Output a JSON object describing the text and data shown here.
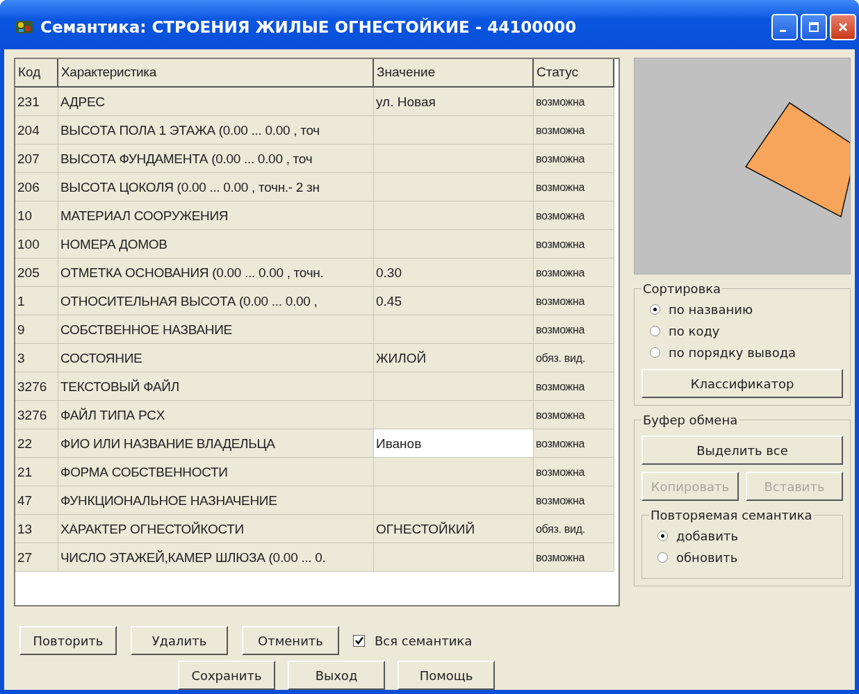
{
  "window": {
    "title": "Семантика: СТРОЕНИЯ ЖИЛЫЕ ОГНЕСТОЙКИЕ - 44100000"
  },
  "table": {
    "columns": [
      "Код",
      "Характеристика",
      "Значение",
      "Статус"
    ],
    "rows": [
      {
        "code": "231",
        "name": "АДРЕС",
        "value": "ул. Новая",
        "status": "возможна",
        "editing": false
      },
      {
        "code": "204",
        "name": "ВЫСОТА ПОЛА 1 ЭТАЖА  (0.00 ... 0.00 , точ",
        "status": "возможна",
        "editing": false
      },
      {
        "code": "207",
        "name": "ВЫСОТА ФУНДАМЕНТА  (0.00 ... 0.00 , точ",
        "status": "возможна",
        "editing": false
      },
      {
        "code": "206",
        "name": "ВЫСОТА ЦОКОЛЯ  (0.00 ... 0.00 , точн.- 2 зн",
        "status": "возможна",
        "editing": false
      },
      {
        "code": "10",
        "name": "МАТЕРИАЛ СООРУЖЕНИЯ",
        "status": "возможна",
        "editing": false
      },
      {
        "code": "100",
        "name": "НОМЕРА ДОМОВ",
        "status": "возможна",
        "editing": false
      },
      {
        "code": "205",
        "name": "ОТМЕТКА ОСНОВАНИЯ  (0.00 ... 0.00 , точн.",
        "value": "0.30",
        "status": "возможна",
        "editing": false
      },
      {
        "code": "1",
        "name": "ОТНОСИТЕЛЬНАЯ ВЫСОТА  (0.00 ... 0.00 ,",
        "value": "0.45",
        "status": "возможна",
        "editing": false
      },
      {
        "code": "9",
        "name": "СОБСТВЕННОЕ НАЗВАНИЕ",
        "status": "возможна",
        "editing": false
      },
      {
        "code": "3",
        "name": "СОСТОЯНИЕ",
        "value": "ЖИЛОЙ",
        "status": "обяз. вид.",
        "editing": false
      },
      {
        "code": "3276",
        "name": "ТЕКСТОВЫЙ ФАЙЛ",
        "status": "возможна",
        "editing": false
      },
      {
        "code": "3276",
        "name": "ФАЙЛ ТИПА PCX",
        "status": "возможна",
        "editing": false
      },
      {
        "code": "22",
        "name": "ФИО ИЛИ НАЗВАНИЕ ВЛАДЕЛЬЦА",
        "value": "Иванов",
        "status": "возможна",
        "editing": true
      },
      {
        "code": "21",
        "name": "ФОРМА СОБСТВЕННОСТИ",
        "status": "возможна",
        "editing": false
      },
      {
        "code": "47",
        "name": "ФУНКЦИОНАЛЬНОЕ НАЗНАЧЕНИЕ",
        "status": "возможна",
        "editing": false
      },
      {
        "code": "13",
        "name": "ХАРАКТЕР ОГНЕСТОЙКОСТИ",
        "value": "ОГНЕСТОЙКИЙ",
        "status": "обяз. вид.",
        "editing": false
      },
      {
        "code": "27",
        "name": "ЧИСЛО ЭТАЖЕЙ,КАМЕР ШЛЮЗА  (0.00 ... 0.",
        "status": "возможна",
        "editing": false
      }
    ]
  },
  "sorting": {
    "title": "Сортировка",
    "options": [
      {
        "label": "по названию",
        "selected": true
      },
      {
        "label": "по коду",
        "selected": false
      },
      {
        "label": "по порядку вывода",
        "selected": false
      }
    ],
    "button": "Классификатор"
  },
  "clipboard": {
    "title": "Буфер обмена",
    "select_all": "Выделить все",
    "buttons": [
      {
        "label": "Копировать",
        "disabled": true
      },
      {
        "label": "Вставить",
        "disabled": true
      }
    ],
    "repeat": {
      "title": "Повторяемая семантика",
      "options": [
        {
          "label": "добавить",
          "selected": true
        },
        {
          "label": "обновить",
          "selected": false
        }
      ]
    }
  },
  "actions": [
    "Повторить",
    "Удалить",
    "Отменить"
  ],
  "all_semantics": {
    "label": "Вся семантика",
    "checked": true
  },
  "footer_buttons": [
    "Сохранить",
    "Выход",
    "Помощь"
  ]
}
